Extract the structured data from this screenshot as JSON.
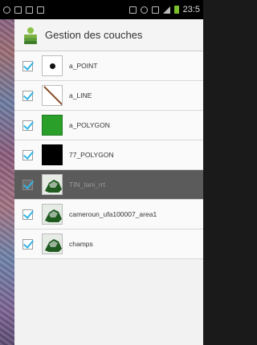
{
  "status_bar": {
    "time": "23:5"
  },
  "header": {
    "title": "Gestion des couches"
  },
  "layers": [
    {
      "name": "a_POINT",
      "visible": true,
      "thumbnail": "point-symbol-icon"
    },
    {
      "name": "a_LINE",
      "visible": true,
      "thumbnail": "line-symbol-icon"
    },
    {
      "name": "a_POLYGON",
      "visible": true,
      "thumbnail": "green-polygon-symbol-icon"
    },
    {
      "name": "77_POLYGON",
      "visible": true,
      "thumbnail": "black-polygon-symbol-icon"
    },
    {
      "name": "TIN_tani_rrt",
      "visible": true,
      "thumbnail": "raster-layer-icon",
      "selected": true
    },
    {
      "name": "cameroun_ufa100007_area1",
      "visible": true,
      "thumbnail": "raster-layer-icon"
    },
    {
      "name": "champs",
      "visible": true,
      "thumbnail": "raster-layer-icon"
    }
  ],
  "colors": {
    "checkbox_check": "#33b5e5",
    "selected_row": "#5b5b5b",
    "green_polygon": "#2aa02a",
    "header_accent": "#7cb342"
  }
}
